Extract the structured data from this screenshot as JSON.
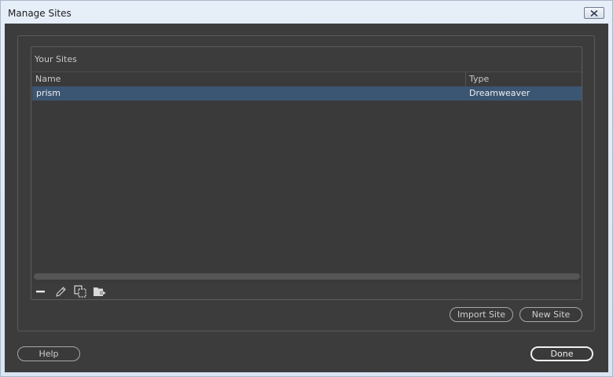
{
  "window": {
    "title": "Manage Sites"
  },
  "sites": {
    "group_label": "Your Sites",
    "columns": {
      "name": "Name",
      "type": "Type"
    },
    "rows": [
      {
        "name": "prism",
        "type": "Dreamweaver",
        "selected": true
      }
    ]
  },
  "toolbar": {
    "icons": [
      "minus-icon",
      "pencil-icon",
      "duplicate-icon",
      "export-icon"
    ]
  },
  "buttons": {
    "import": "Import Site",
    "new_site": "New Site",
    "help": "Help",
    "done": "Done"
  },
  "colors": {
    "background": "#3c3c3c",
    "selection": "#3b5672",
    "text": "#c9c9c9"
  }
}
